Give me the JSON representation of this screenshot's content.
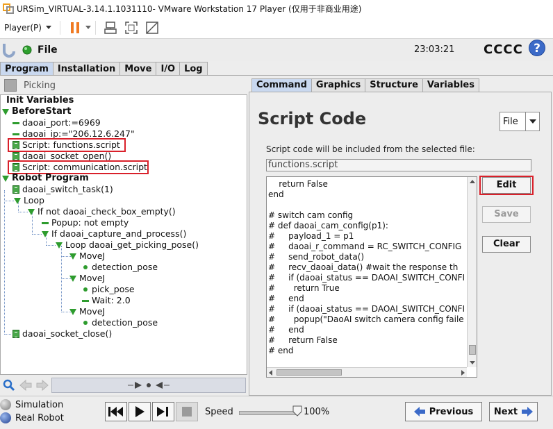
{
  "window": {
    "title": "URSim_VIRTUAL-3.14.1.1031110- VMware Workstation 17 Player (仅用于非商业用途)"
  },
  "vmware_toolbar": {
    "player_menu": "Player(P)"
  },
  "header": {
    "file_label": "File",
    "clock": "23:03:21",
    "robot_name": "CCCC",
    "help": "?"
  },
  "main_tabs": [
    {
      "label": "Program",
      "active": true
    },
    {
      "label": "Installation",
      "active": false
    },
    {
      "label": "Move",
      "active": false
    },
    {
      "label": "I/O",
      "active": false
    },
    {
      "label": "Log",
      "active": false
    }
  ],
  "left_panel": {
    "program_name": "Picking"
  },
  "tree": [
    "Init Variables",
    "BeforeStart",
    "daoai_port:=6969",
    "daoai_ip:=\"206.12.6.247\"",
    "Script: functions.script",
    "daoai_socket_open()",
    "Script: communication.script",
    "Robot Program",
    "daoai_switch_task(1)",
    "Loop",
    "If  not daoai_check_box_empty()",
    "Popup: not empty",
    "If daoai_capture_and_process()",
    "Loop daoai_get_picking_pose()",
    "MoveJ",
    "detection_pose",
    "MoveJ",
    "pick_pose",
    "Wait: 2.0",
    "MoveJ",
    "detection_pose",
    "daoai_socket_close()"
  ],
  "right_tabs": [
    {
      "label": "Command",
      "active": true
    },
    {
      "label": "Graphics",
      "active": false
    },
    {
      "label": "Structure",
      "active": false
    },
    {
      "label": "Variables",
      "active": false
    }
  ],
  "script_panel": {
    "title": "Script Code",
    "source_select": "File",
    "description": "Script code will be included from the selected file:",
    "filename": "functions.script",
    "code": "    return False\nend\n\n# switch cam config\n# def daoai_cam_config(p1):\n#     payload_1 = p1\n#     daoai_r_command = RC_SWITCH_CONFIG\n#     send_robot_data()\n#     recv_daoai_data() #wait the response th\n#     if (daoai_status == DAOAI_SWITCH_CONFI\n#       return True\n#     end\n#     if (daoai_status == DAOAI_SWITCH_CONFI\n#       popup(\"DaoAI switch camera config faile\n#     end\n#     return False\n# end",
    "edit_button": "Edit",
    "save_button": "Save",
    "clear_button": "Clear"
  },
  "footer": {
    "simulation_label": "Simulation",
    "real_robot_label": "Real Robot",
    "speed_label": "Speed",
    "speed_value": "100%",
    "speed_fraction": 1.0,
    "previous_button": "Previous",
    "next_button": "Next"
  },
  "colors": {
    "accent_blue": "#3b6ac8",
    "tree_green": "#2e9c2e",
    "highlight_red": "#d9202a",
    "active_tab": "#c9d8ef"
  }
}
